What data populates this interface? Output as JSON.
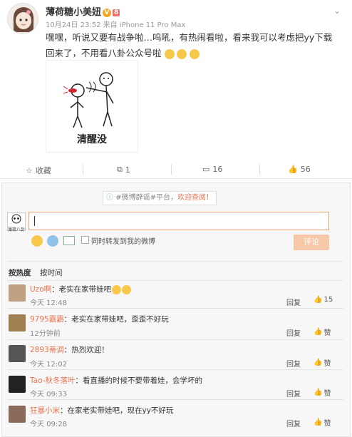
{
  "post": {
    "user_name": "薄荷糖小美妞",
    "user_tag": "(薇若)",
    "level_badge": "8",
    "time": "10月24日 23:52",
    "source_prefix": "来自",
    "device": "iPhone 11 Pro Max",
    "text": "嘿嘿，听说又要有战争啦…呜吼，有热闹看啦，看来我可以考虑把yy下载回来了，不用看八卦公众号啦",
    "image_caption": "清醒没"
  },
  "actions": {
    "favorite": "收藏",
    "repost_count": "1",
    "comment_count": "16",
    "like_count": "56"
  },
  "comment_box": {
    "notice_prefix": "#微博辟谣#平台，",
    "notice_link": "欢迎查阅！",
    "avatar_text": "薄荷八卦",
    "repost_label": "同时转发到我的微博",
    "submit_label": "评论"
  },
  "sort": {
    "by_hot": "按热度",
    "by_time": "按时间"
  },
  "comments": [
    {
      "user": "Uzo啊",
      "text": "：老实在家带娃吧",
      "time": "今天 12:48",
      "reply": "回复",
      "like": "15",
      "avatar_color": "#c0a080"
    },
    {
      "user": "9795霸霸",
      "text": "：老实在家带娃吧，歪歪不好玩",
      "time": "12分钟前",
      "reply": "回复",
      "like": "赞",
      "avatar_color": "#a08050"
    },
    {
      "user": "2893蒂调",
      "text": "：热烈欢迎！",
      "time": "今天 12:02",
      "reply": "回复",
      "like": "赞",
      "avatar_color": "#555555"
    },
    {
      "user": "Tao-秋冬落叶",
      "text": "：看直播的时候不要带着娃，会学坏的",
      "time": "今天 09:33",
      "reply": "回复",
      "like": "赞",
      "avatar_color": "#222222"
    },
    {
      "user": "狂暴小米",
      "text": "：在家老实带娃吧，现在yy不好玩",
      "time": "今天 09:28",
      "reply": "回复",
      "like": "赞",
      "avatar_color": "#8a6a5a"
    }
  ],
  "colors": {
    "accent": "#eb7350",
    "link_orange": "#eb7350",
    "submit_disabled": "#f7c8a8"
  }
}
